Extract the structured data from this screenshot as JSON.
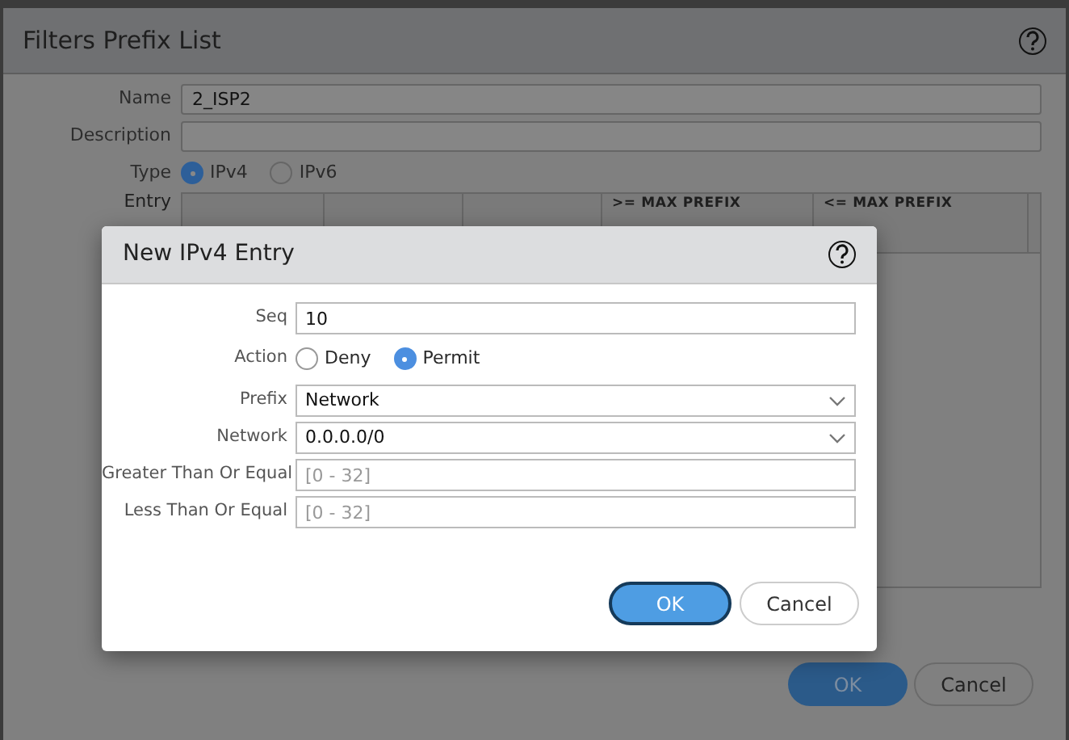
{
  "background_dialog": {
    "title": "Filters Prefix List",
    "fields": [
      {
        "label": "Name",
        "value": "2_ISP2"
      },
      {
        "label": "Description"
      }
    ],
    "type": {
      "label": "Type",
      "options": [
        {
          "label": "IPv4",
          "selected": true
        },
        {
          "label": "IPv6",
          "selected": false
        }
      ]
    },
    "entry": {
      "label": "Entry",
      "columns": [
        "",
        "",
        "",
        ">= MAX PREFIX",
        "<= MAX PREFIX"
      ]
    },
    "buttons": [
      {
        "label": "OK",
        "kind": "primary"
      },
      {
        "label": "Cancel",
        "kind": "secondary"
      }
    ]
  },
  "modal": {
    "title": "New IPv4 Entry",
    "rows": [
      {
        "kind": "text",
        "label": "Seq",
        "value": "10"
      },
      {
        "kind": "radio",
        "label": "Action",
        "options": [
          {
            "label": "Deny",
            "selected": false
          },
          {
            "label": "Permit",
            "selected": true
          }
        ]
      },
      {
        "kind": "select",
        "label": "Prefix",
        "value": "Network"
      },
      {
        "kind": "select",
        "label": "Network",
        "value": "0.0.0.0/0"
      },
      {
        "kind": "text",
        "label": "Greater Than Or Equal",
        "placeholder": "[0 - 32]"
      },
      {
        "kind": "text",
        "label": "Less Than Or Equal",
        "placeholder": "[0 - 32]"
      }
    ],
    "buttons": [
      {
        "label": "OK",
        "kind": "primary"
      },
      {
        "label": "Cancel",
        "kind": "secondary"
      }
    ]
  }
}
